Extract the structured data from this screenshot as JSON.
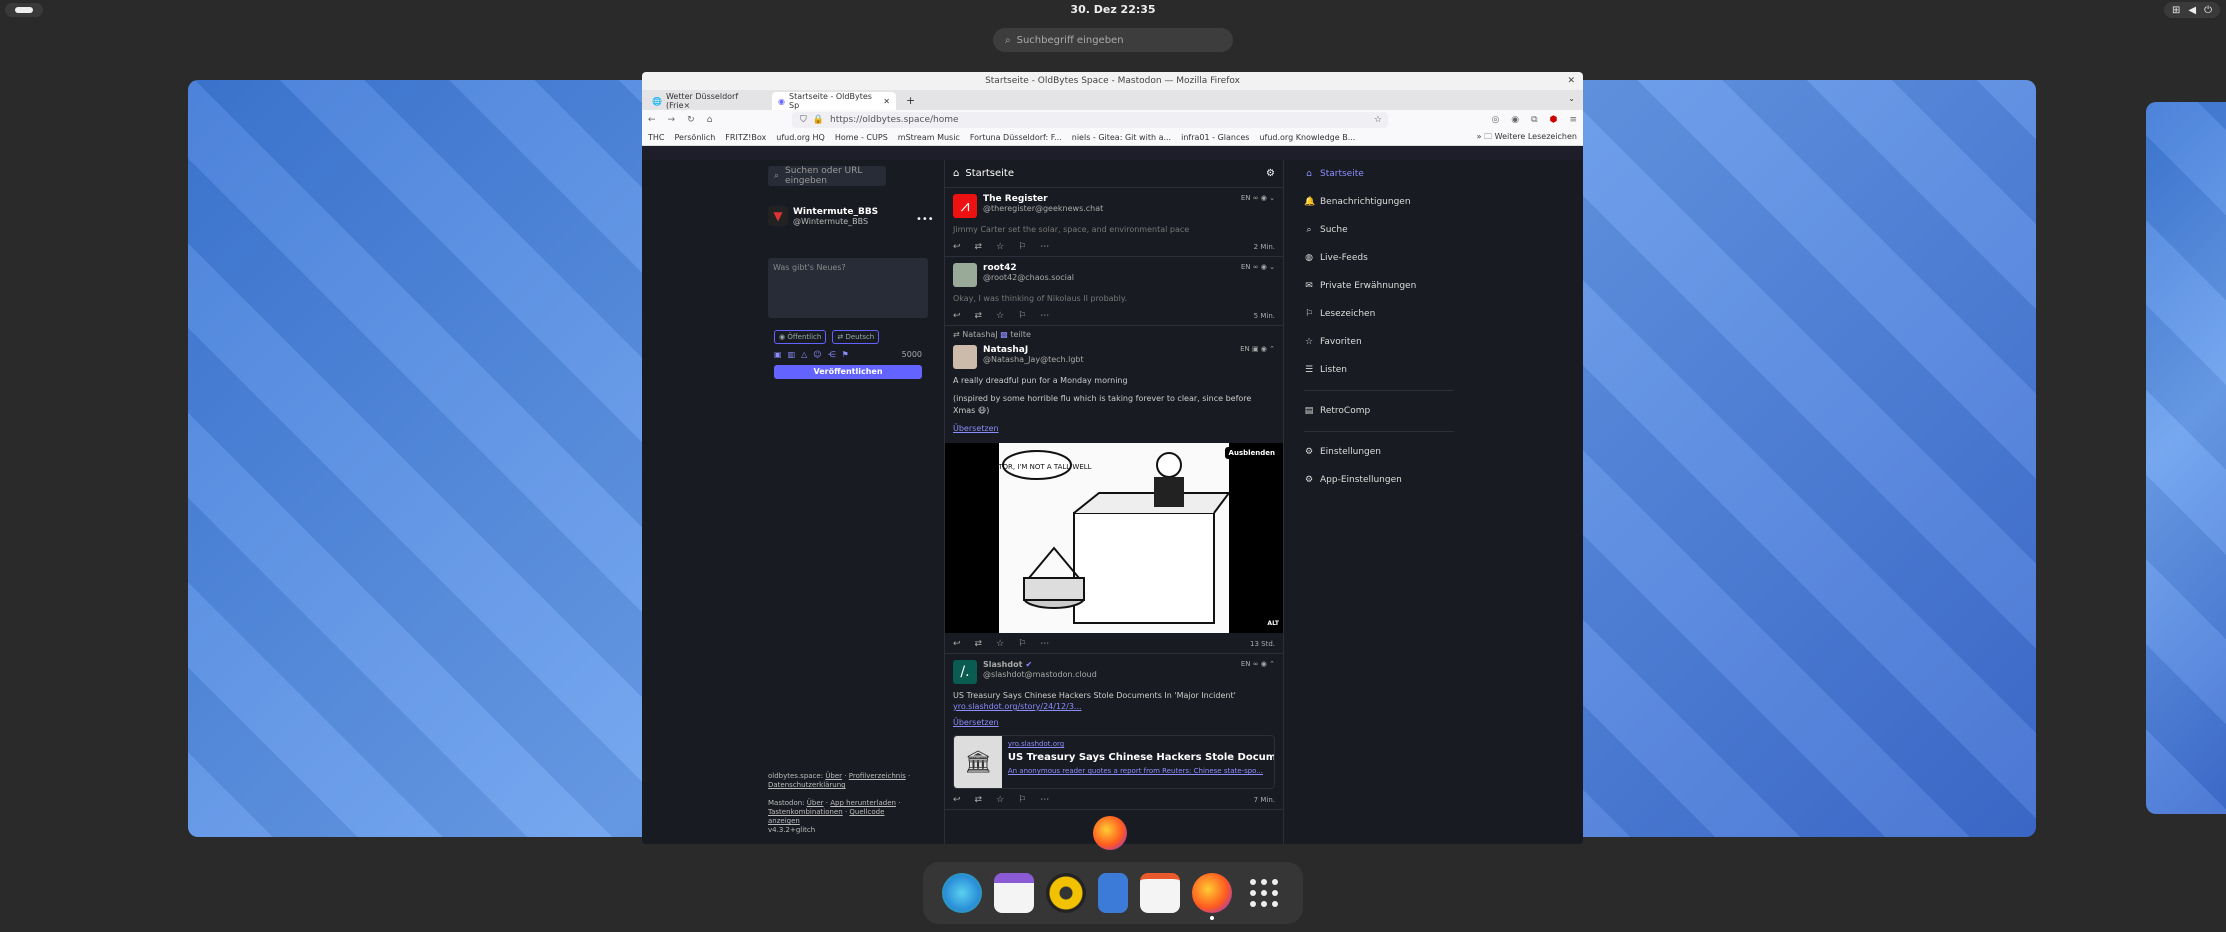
{
  "topbar": {
    "clock": "30. Dez  22:35"
  },
  "overview_search": {
    "placeholder": "Suchbegriff eingeben"
  },
  "window": {
    "title": "Startseite - OldBytes Space - Mastodon — Mozilla Firefox"
  },
  "tabs": [
    {
      "label": "Wetter Düsseldorf (Frie×"
    },
    {
      "label": "Startseite - OldBytes Sp"
    }
  ],
  "url": "https://oldbytes.space/home",
  "bookmarks": [
    "THC",
    "Persönlich",
    "FRITZ!Box",
    "ufud.org HQ",
    "Home - CUPS",
    "mStream Music",
    "Fortuna Düsseldorf: F...",
    "niels - Gitea: Git with a...",
    "infra01 - Glances",
    "ufud.org Knowledge B..."
  ],
  "bookmarks_other": "Weitere Lesezeichen",
  "left": {
    "search_placeholder": "Suchen oder URL eingeben",
    "account_name": "Wintermute_BBS",
    "account_handle": "@Wintermute_BBS",
    "compose_placeholder": "Was gibt's Neues?",
    "visibility": "Öffentlich",
    "language": "Deutsch",
    "char_count": "5000",
    "publish": "Veröffentlichen",
    "footer": {
      "site": "oldbytes.space:",
      "about": "Über",
      "directory": "Profilverzeichnis",
      "privacy": "Datenschutzerklärung",
      "mastodon": "Mastodon:",
      "about2": "Über",
      "app": "App herunterladen",
      "shortcuts": "Tastenkombinationen",
      "source": "Quellcode anzeigen",
      "version": "v4.3.2+glitch"
    }
  },
  "feed": {
    "title": "Startseite",
    "posts": [
      {
        "name": "The Register",
        "handle": "@theregister@geeknews.chat",
        "lang": "EN",
        "text": "Jimmy Carter set the solar, space, and environmental pace",
        "time": "2 Min."
      },
      {
        "name": "root42",
        "handle": "@root42@chaos.social",
        "lang": "EN",
        "text": "Okay, I was thinking of Nikolaus II probably.",
        "time": "5 Min."
      },
      {
        "boosted_by": "NatashaJ",
        "boost_suffix": "teilte",
        "name": "NatashaJ",
        "handle": "@Natasha_Jay@tech.lgbt",
        "lang": "EN",
        "text": "A really dreadful pun for a Monday morning",
        "text2": "(inspired by some horrible flu which is taking forever to clear, since before Xmas 😷)",
        "translate": "Übersetzen",
        "hide": "Ausblenden",
        "alt": "ALT",
        "time": "13 Std.",
        "cartoon_text": "DOCTOR, I'M NOT A TALL WELL"
      },
      {
        "name": "Slashdot",
        "handle": "@slashdot@mastodon.cloud",
        "lang": "EN",
        "text": "US Treasury Says Chinese Hackers Stole Documents In 'Major Incident'",
        "link": "yro.slashdot.org/story/24/12/3...",
        "translate": "Übersetzen",
        "card_domain": "yro.slashdot.org",
        "card_title": "US Treasury Says Chinese Hackers Stole Documen...",
        "card_desc": "An anonymous reader quotes a report from Reuters: Chinese state-spo...",
        "time": "7 Min."
      }
    ]
  },
  "nav": [
    {
      "label": "Startseite",
      "icon": "home-icon"
    },
    {
      "label": "Benachrichtigungen",
      "icon": "bell-icon"
    },
    {
      "label": "Suche",
      "icon": "search-icon"
    },
    {
      "label": "Live-Feeds",
      "icon": "globe-icon"
    },
    {
      "label": "Private Erwähnungen",
      "icon": "mail-icon"
    },
    {
      "label": "Lesezeichen",
      "icon": "bookmark-icon"
    },
    {
      "label": "Favoriten",
      "icon": "star-icon"
    },
    {
      "label": "Listen",
      "icon": "list-icon"
    },
    {
      "label": "RetroComp",
      "icon": "list-icon"
    },
    {
      "label": "Einstellungen",
      "icon": "gear-icon"
    },
    {
      "label": "App-Einstellungen",
      "icon": "sliders-icon"
    }
  ],
  "colors": {
    "accent": "#6364ff",
    "link": "#8c8dff"
  }
}
